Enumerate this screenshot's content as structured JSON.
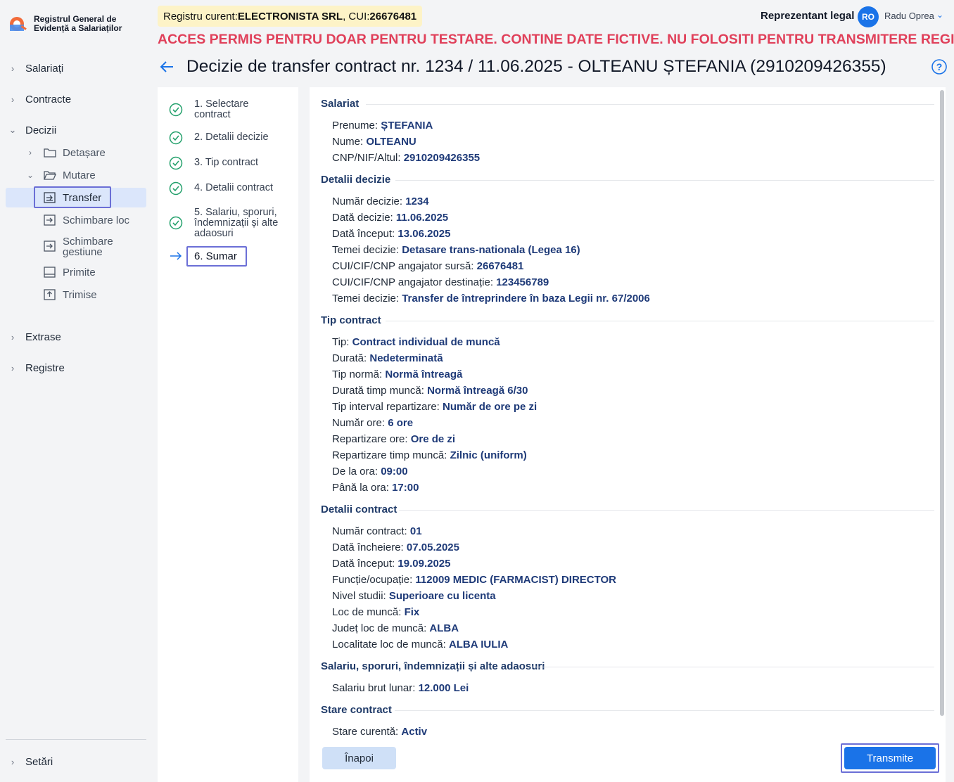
{
  "app": {
    "logo_line1": "Registrul General de",
    "logo_line2": "Evidență a Salariaților"
  },
  "sidebar": {
    "items": [
      {
        "label": "Salariați"
      },
      {
        "label": "Contracte"
      },
      {
        "label": "Decizii"
      },
      {
        "label": "Extrase"
      },
      {
        "label": "Registre"
      },
      {
        "label": "Setări"
      }
    ],
    "decizii_children": [
      {
        "label": "Detașare"
      },
      {
        "label": "Mutare"
      },
      {
        "label": "Transfer"
      },
      {
        "label": "Schimbare loc"
      },
      {
        "label": "Schimbare gestiune"
      },
      {
        "label": "Primite"
      },
      {
        "label": "Trimise"
      }
    ]
  },
  "header": {
    "registry_prefix": "Registru curent: ",
    "registry_company": "ELECTRONISTA SRL",
    "registry_cui_prefix": ", CUI: ",
    "registry_cui": "26676481",
    "warning": "ACCES PERMIS PENTRU DOAR PENTRU TESTARE. CONTINE DATE FICTIVE. NU FOLOSITI PENTRU TRANSMITERE REGISTRU",
    "role": "Reprezentant legal",
    "avatar_initials": "RO",
    "user_name": "Radu Oprea"
  },
  "page": {
    "title": "Decizie de transfer contract nr. 1234 / 11.06.2025 - OLTEANU  ȘTEFANIA (2910209426355)"
  },
  "steps": [
    {
      "line1": "1. Selectare",
      "line2": "contract",
      "line3": ""
    },
    {
      "line1": "2. Detalii decizie",
      "line2": "",
      "line3": ""
    },
    {
      "line1": "3. Tip contract",
      "line2": "",
      "line3": ""
    },
    {
      "line1": "4. Detalii contract",
      "line2": "",
      "line3": ""
    },
    {
      "line1": "5. Salariu, sporuri,",
      "line2": "îndemnizații și alte",
      "line3": "adaosuri"
    },
    {
      "line1": "6. Sumar",
      "line2": "",
      "line3": ""
    }
  ],
  "summary": {
    "salariat": {
      "title": "Salariat",
      "rows": [
        {
          "label": "Prenume:  ",
          "value": "ȘTEFANIA"
        },
        {
          "label": "Nume: ",
          "value": "OLTEANU"
        },
        {
          "label": "CNP/NIF/Altul: ",
          "value": "2910209426355"
        }
      ]
    },
    "detalii_decizie": {
      "title": "Detalii decizie",
      "rows": [
        {
          "label": "Număr decizie: ",
          "value": "1234"
        },
        {
          "label": "Dată decizie: ",
          "value": "11.06.2025"
        },
        {
          "label": "Dată început: ",
          "value": "13.06.2025"
        },
        {
          "label": "Temei decizie: ",
          "value": "Detasare trans-nationala (Legea 16)"
        },
        {
          "label": "CUI/CIF/CNP angajator sursă: ",
          "value": "26676481"
        },
        {
          "label": "CUI/CIF/CNP angajator destinație: ",
          "value": "123456789"
        },
        {
          "label": "Temei decizie: ",
          "value": "Transfer de întreprindere în baza Legii nr. 67/2006"
        }
      ]
    },
    "tip_contract": {
      "title": "Tip contract",
      "rows": [
        {
          "label": "Tip: ",
          "value": "Contract individual de muncă"
        },
        {
          "label": "Durată: ",
          "value": "Nedeterminată"
        },
        {
          "label": "Tip normă: ",
          "value": "Normă întreagă"
        },
        {
          "label": "Durată timp muncă: ",
          "value": "Normă întreagă 6/30"
        },
        {
          "label": "Tip interval repartizare: ",
          "value": "Număr de ore pe zi"
        },
        {
          "label": "Număr ore: ",
          "value": "6 ore"
        },
        {
          "label": "Repartizare ore: ",
          "value": "Ore de zi"
        },
        {
          "label": "Repartizare timp muncă: ",
          "value": "Zilnic (uniform)"
        },
        {
          "label": "De la ora: ",
          "value": "09:00"
        },
        {
          "label": "Până la ora: ",
          "value": "17:00"
        }
      ]
    },
    "detalii_contract": {
      "title": "Detalii contract",
      "rows": [
        {
          "label": "Număr contract: ",
          "value": "01"
        },
        {
          "label": "Dată încheiere: ",
          "value": "07.05.2025"
        },
        {
          "label": "Dată început: ",
          "value": "19.09.2025"
        },
        {
          "label": "Funcție/ocupație: ",
          "value": "112009 MEDIC (FARMACIST) DIRECTOR"
        },
        {
          "label": "Nivel studii: ",
          "value": "Superioare cu licenta"
        },
        {
          "label": "Loc de muncă: ",
          "value": "Fix"
        },
        {
          "label": "Județ loc de muncă: ",
          "value": "ALBA"
        },
        {
          "label": "Localitate loc de muncă: ",
          "value": "ALBA IULIA"
        }
      ]
    },
    "salariu": {
      "title": "Salariu, sporuri, îndemnizații și alte adaosuri",
      "rows": [
        {
          "label": "Salariu brut lunar: ",
          "value": "12.000 Lei"
        }
      ]
    },
    "stare": {
      "title": "Stare contract",
      "rows": [
        {
          "label": "Stare curentă: ",
          "value": "Activ"
        }
      ]
    }
  },
  "actions": {
    "back_label": "Înapoi",
    "send_label": "Transmite"
  },
  "colors": {
    "primary": "#1a73e8",
    "warning": "#e0405a",
    "value_text": "#1e3a78",
    "success": "#22a06b",
    "focus_outline": "#6b6fd6"
  }
}
